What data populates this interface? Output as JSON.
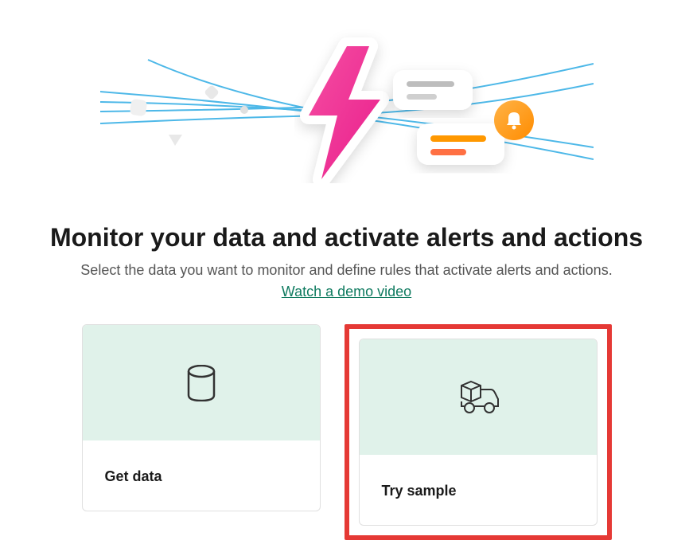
{
  "heading": "Monitor your data and activate alerts and actions",
  "subheading": "Select the data you want to monitor and define rules that activate alerts and actions.",
  "demo_link_label": "Watch a demo video",
  "cards": {
    "get_data": {
      "label": "Get data"
    },
    "try_sample": {
      "label": "Try sample"
    }
  }
}
